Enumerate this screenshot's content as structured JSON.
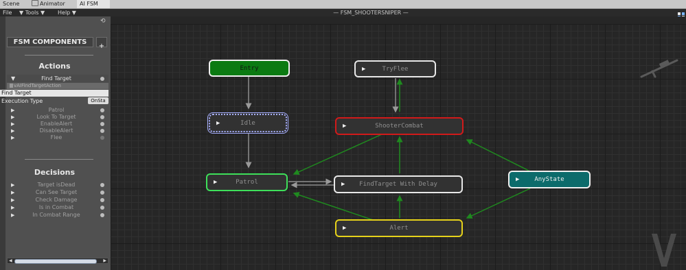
{
  "tabs": [
    {
      "label": "Scene"
    },
    {
      "label": "Animator",
      "icon": "animator-icon"
    },
    {
      "label": "AI FSM"
    }
  ],
  "menu": {
    "file": "File",
    "tools": "▼ Tools ▼",
    "help": "Help ▼"
  },
  "window_title": "— FSM_SHOOTERSNIPER —",
  "sidebar": {
    "components_title": "FSM COMPONENTS",
    "add_button": "+",
    "actions_title": "Actions",
    "actions": [
      {
        "label": "Find Target",
        "expanded": true
      },
      {
        "label": "Patrol"
      },
      {
        "label": "Look To Target"
      },
      {
        "label": "EnableAlert"
      },
      {
        "label": "DisableAlert"
      },
      {
        "label": "Flee"
      }
    ],
    "expanded": {
      "script_name": "vAIFindTargetAction",
      "name_value": "Find Target",
      "execution_label": "Execution Type",
      "execution_value": "OnSta"
    },
    "decisions_title": "Decisions",
    "decisions": [
      {
        "label": "Target isDead"
      },
      {
        "label": "Can See Target"
      },
      {
        "label": "Check Damage"
      },
      {
        "label": "Is in Combat"
      },
      {
        "label": "In Combat Range"
      }
    ]
  },
  "states": [
    {
      "label": "Entry",
      "kind": "entry"
    },
    {
      "label": "TryFlee"
    },
    {
      "label": "Idle",
      "selected": true
    },
    {
      "label": "ShooterCombat",
      "kind": "combat"
    },
    {
      "label": "Patrol",
      "kind": "active"
    },
    {
      "label": "FindTarget With Delay"
    },
    {
      "label": "AnyState",
      "kind": "anystate"
    },
    {
      "label": "Alert",
      "kind": "alert"
    }
  ],
  "colors": {
    "entry": "#0b7a12",
    "anystate": "#0c6b6b",
    "combat_accent": "#d21a1a",
    "active_accent": "#3ee05a",
    "alert_accent": "#e6d21a",
    "selected_accent": "#a8b0ff",
    "transition_green": "#1f8a1f",
    "transition_gray": "#8c8c8c"
  }
}
